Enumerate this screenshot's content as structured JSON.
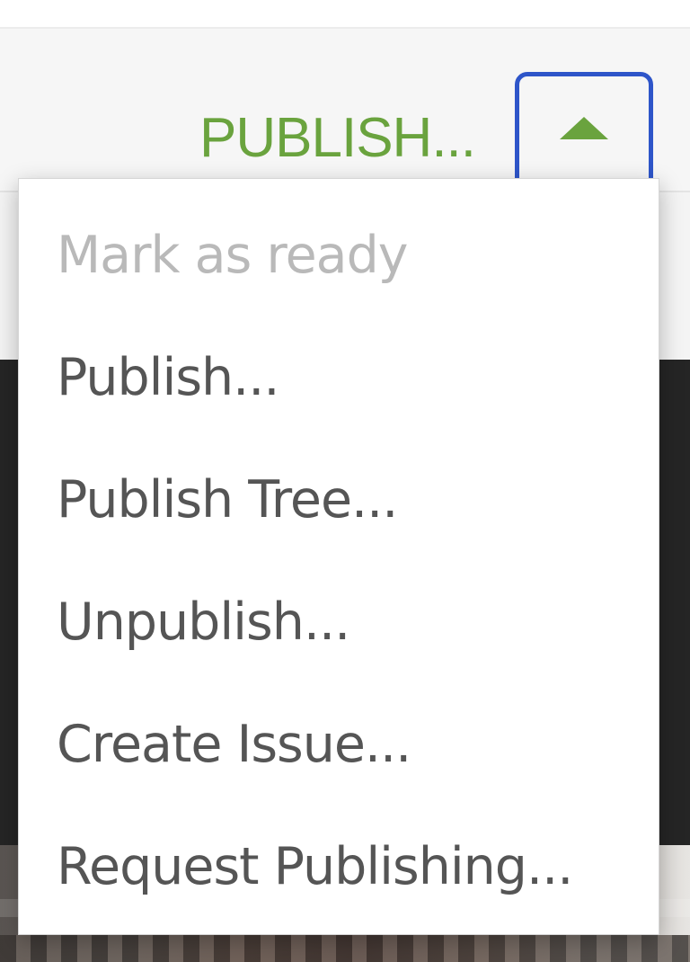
{
  "toolbar": {
    "publish_label": "PUBLISH...",
    "toggle_icon": "caret-up-icon",
    "accent_color": "#6aa33e",
    "focus_color": "#2e55c9"
  },
  "menu": {
    "items": [
      {
        "label": "Mark as ready",
        "disabled": true
      },
      {
        "label": "Publish...",
        "disabled": false
      },
      {
        "label": "Publish Tree...",
        "disabled": false
      },
      {
        "label": "Unpublish...",
        "disabled": false
      },
      {
        "label": "Create Issue...",
        "disabled": false
      },
      {
        "label": "Request Publishing...",
        "disabled": false
      }
    ]
  }
}
